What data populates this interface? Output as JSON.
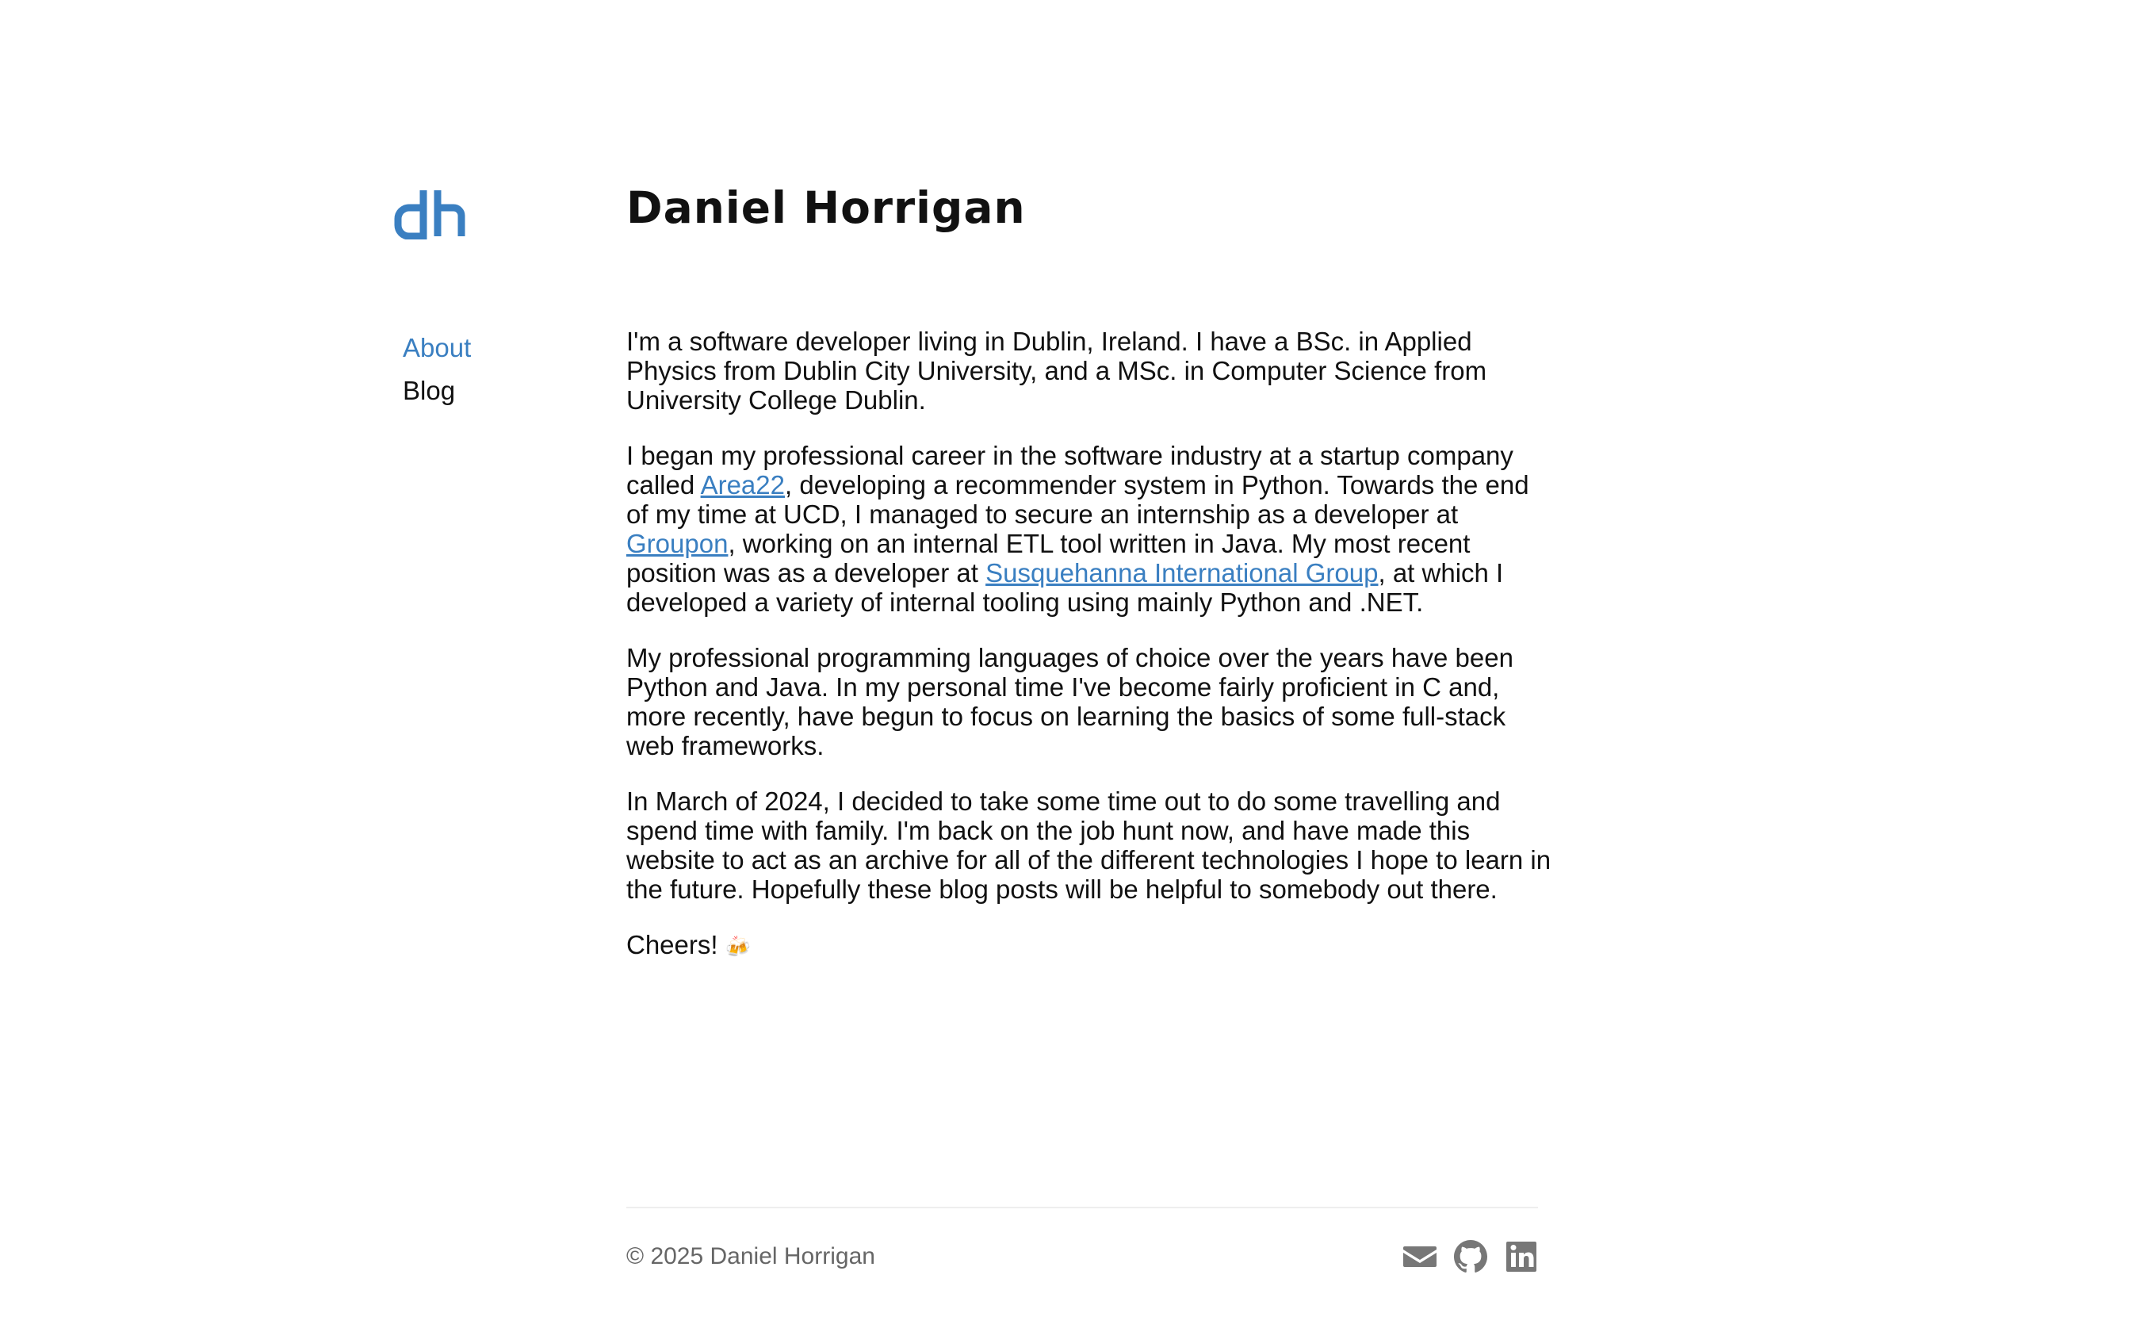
{
  "site": {
    "logo_text": "dh",
    "title": "Daniel Horrigan"
  },
  "nav": {
    "items": [
      {
        "label": "About",
        "active": true
      },
      {
        "label": "Blog",
        "active": false
      }
    ]
  },
  "about": {
    "p1": "I'm a software developer living in Dublin, Ireland. I have a BSc. in Applied Physics from Dublin City University, and a MSc. in Computer Science from University College Dublin.",
    "p2": {
      "t1": "I began my professional career in the software industry at a startup company called ",
      "link1": "Area22",
      "t2": ", developing a recommender system in Python. Towards the end of my time at UCD, I managed to secure an internship as a developer at ",
      "link2": "Groupon",
      "t3": ", working on an internal ETL tool written in Java. My most recent position was as a developer at ",
      "link3": "Susquehanna International Group",
      "t4": ", at which I developed a variety of internal tooling using mainly Python and .NET."
    },
    "p3": "My professional programming languages of choice over the years have been Python and Java. In my personal time I've become fairly proficient in C and, more recently, have begun to focus on learning the basics of some full-stack web frameworks.",
    "p4": "In March of 2024, I decided to take some time out to do some travelling and spend time with family. I'm back on the job hunt now, and have made this website to act as an archive for all of the different technologies I hope to learn in the future. Hopefully these blog posts will be helpful to somebody out there.",
    "p5": "Cheers!",
    "p5_emoji": "🍻"
  },
  "footer": {
    "copyright": "© 2025 Daniel Horrigan",
    "icons": [
      "email-icon",
      "github-icon",
      "linkedin-icon"
    ]
  },
  "colors": {
    "accent": "#3a7fc1",
    "text": "#111111",
    "muted": "#666666",
    "icon": "#777777"
  }
}
